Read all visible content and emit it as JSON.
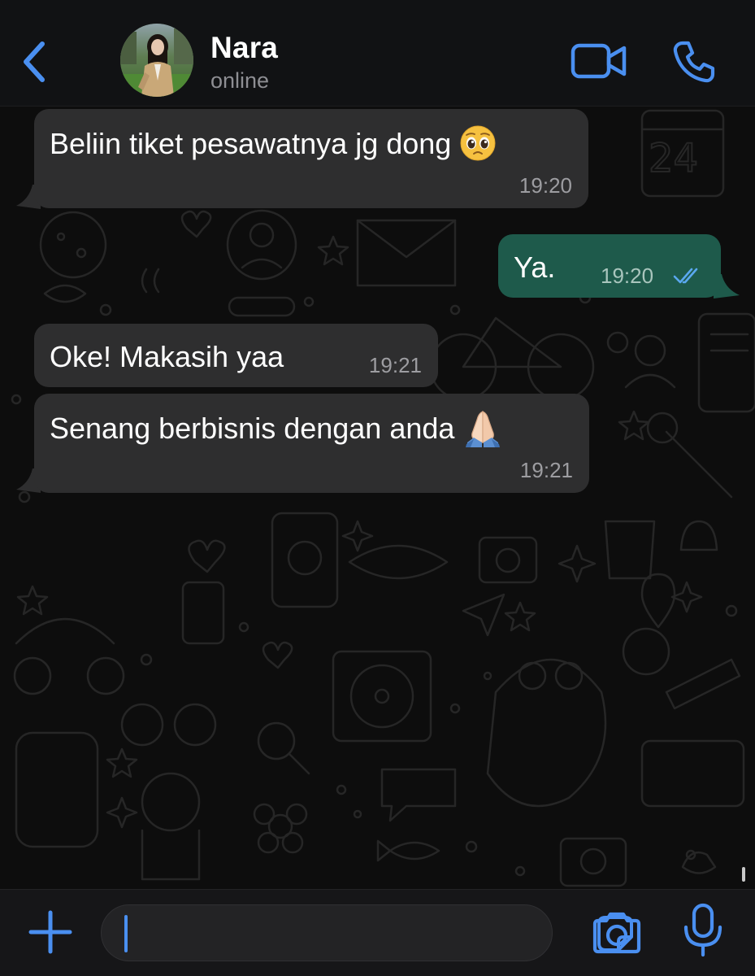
{
  "contact": {
    "name": "Nara",
    "status": "online"
  },
  "messages": [
    {
      "direction": "incoming",
      "text": "Beliin tiket pesawatnya jg dong",
      "emoji": "pleading-face-emoji",
      "time": "19:20"
    },
    {
      "direction": "outgoing",
      "text": "Ya.",
      "time": "19:20",
      "receipt": "double-check-read"
    },
    {
      "direction": "incoming",
      "text": "Oke! Makasih yaa",
      "time": "19:21"
    },
    {
      "direction": "incoming",
      "text": "Senang berbisnis dengan anda",
      "emoji": "folded-hands-emoji",
      "time": "19:21"
    }
  ],
  "composer": {
    "value": "",
    "placeholder": ""
  },
  "colors": {
    "accent": "#4a8ff0",
    "header_bg": "#111214",
    "incoming_bubble": "#2e2e2f",
    "outgoing_bubble": "#1e5a4b",
    "chat_bg": "#0d0d0d",
    "read_receipt": "#5aa8ef"
  },
  "icons": {
    "back": "chevron-left-icon",
    "video": "video-camera-icon",
    "call": "phone-icon",
    "plus": "plus-icon",
    "sticker": "sticker-icon",
    "camera": "camera-icon",
    "mic": "microphone-icon"
  }
}
